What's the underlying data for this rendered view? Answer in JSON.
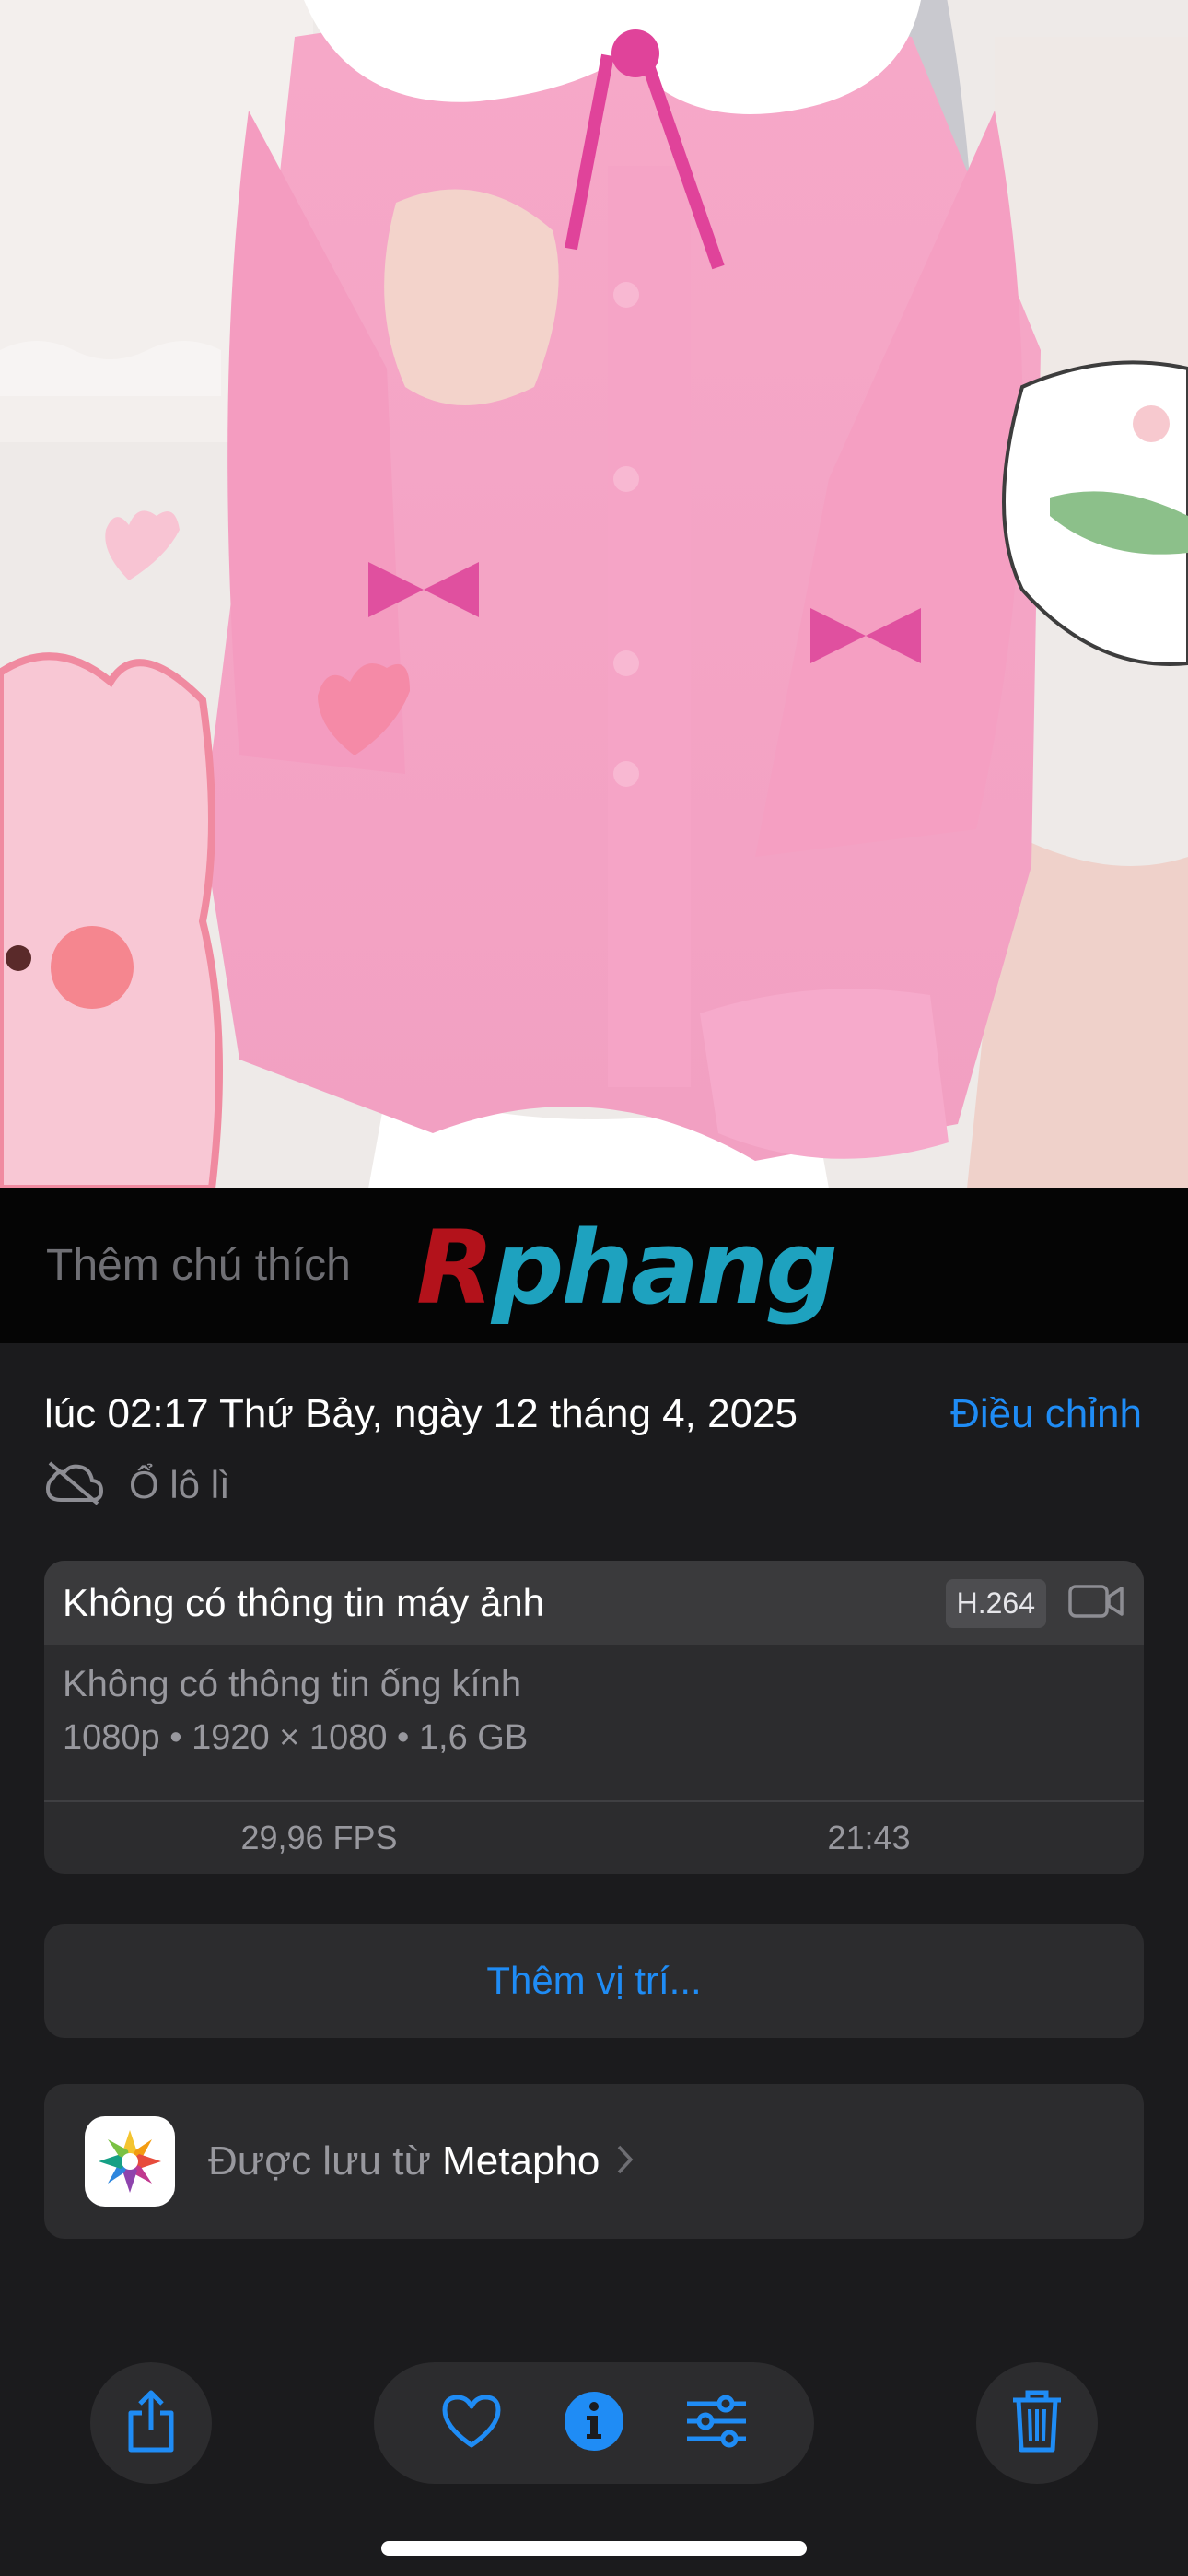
{
  "caption": {
    "placeholder": "Thêm chú thích"
  },
  "watermark": {
    "part1": "R",
    "part2": "phang"
  },
  "info": {
    "date_time": "lúc 02:17 Thứ Bảy, ngày 12 tháng 4, 2025",
    "adjust_label": "Điều chỉnh",
    "album_label": "Ổ lô lì",
    "camera_info": "Không có thông tin máy ảnh",
    "codec": "H.264",
    "lens_info": "Không có thông tin ống kính",
    "specs": "1080p  •  1920 × 1080  •  1,6 GB",
    "fps": "29,96 FPS",
    "duration": "21:43",
    "add_location": "Thêm vị trí...",
    "saved_from_prefix": "Được lưu từ ",
    "saved_from_app": "Metapho"
  },
  "toolbar": {
    "icons": [
      "share-icon",
      "heart-icon",
      "info-icon",
      "adjust-icon",
      "trash-icon"
    ]
  },
  "colors": {
    "accent": "#1f8cf5",
    "panel_bg": "#1b1b1d",
    "card_bg": "#2c2c2e",
    "secondary_text": "#98989e"
  }
}
